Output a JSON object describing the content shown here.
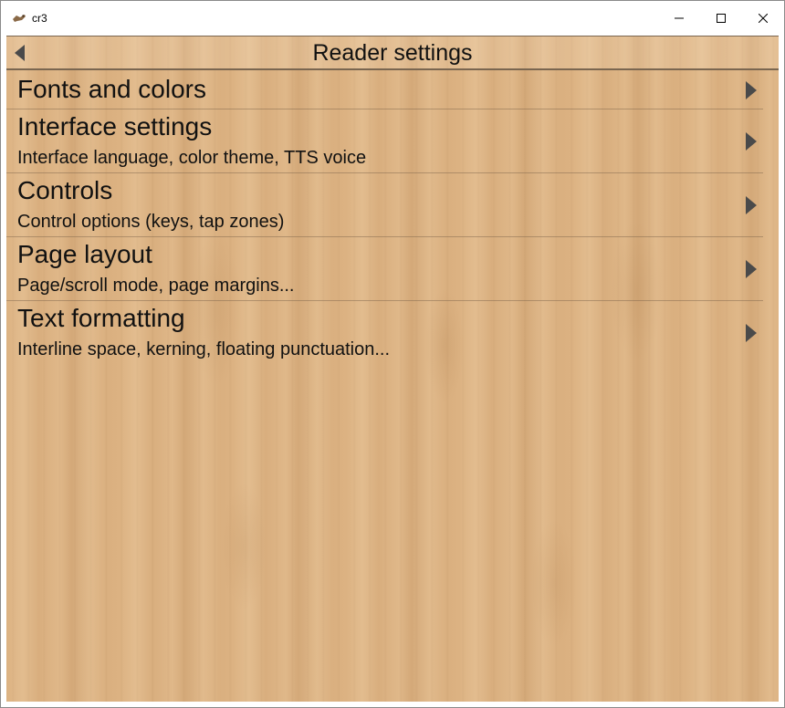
{
  "window": {
    "title": "cr3",
    "app_icon": "cr3-app-icon",
    "controls": [
      "minimize-icon",
      "maximize-icon",
      "close-icon"
    ]
  },
  "header": {
    "title": "Reader settings",
    "back_icon": "triangle-left-icon"
  },
  "menu": {
    "items": [
      {
        "title": "Fonts and colors",
        "subtitle": ""
      },
      {
        "title": "Interface settings",
        "subtitle": "Interface language, color theme, TTS voice"
      },
      {
        "title": "Controls",
        "subtitle": "Control options (keys, tap zones)"
      },
      {
        "title": "Page layout",
        "subtitle": "Page/scroll mode, page margins..."
      },
      {
        "title": "Text formatting",
        "subtitle": "Interline space, kerning, floating punctuation..."
      }
    ],
    "chevron_icon": "triangle-right-icon"
  },
  "colors": {
    "wood_background": "#dcb282",
    "text": "#111111",
    "icon": "#4a4a4a",
    "divider": "#7a6650"
  }
}
